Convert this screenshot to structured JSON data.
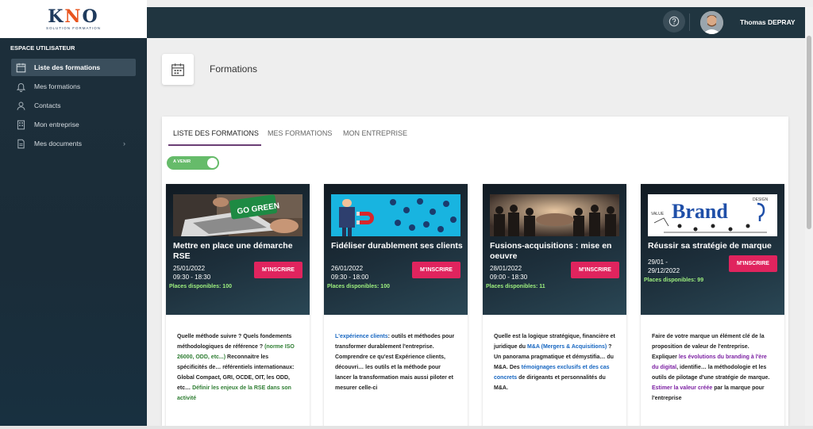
{
  "logo": {
    "brand": "KNO",
    "tagline": "SOLUTION FORMATION"
  },
  "sidebar": {
    "heading": "ESPACE UTILISATEUR",
    "items": [
      {
        "label": "Liste des formations",
        "icon": "calendar-icon",
        "active": true
      },
      {
        "label": "Mes formations",
        "icon": "bell-icon",
        "active": false
      },
      {
        "label": "Contacts",
        "icon": "person-icon",
        "active": false
      },
      {
        "label": "Mon entreprise",
        "icon": "building-icon",
        "active": false
      },
      {
        "label": "Mes documents",
        "icon": "document-icon",
        "active": false,
        "expandable": true
      }
    ]
  },
  "topbar": {
    "user_name": "Thomas DEPRAY",
    "help_icon": "help-icon"
  },
  "page": {
    "title": "Formations",
    "icon": "calendar-icon"
  },
  "tabs": [
    {
      "label": "LISTE DES FORMATIONS",
      "active": true
    },
    {
      "label": "MES FORMATIONS",
      "active": false
    },
    {
      "label": "MON ENTREPRISE",
      "active": false
    }
  ],
  "toggle": {
    "label": "A VENIR",
    "on": true
  },
  "cards": [
    {
      "title": "Mettre en place une démarche RSE",
      "date": "25/01/2022",
      "time": "09:30 - 18:30",
      "button": "M'INSCRIRE",
      "places": "Places disponibles: 100",
      "description": {
        "p1": "Quelle méthode suivre ? Quels fondements méthodologiques de référence ? ",
        "h1": "(norme ISO 26000, ODD, etc...)",
        "p2": " Reconnaitre les spécificités de… référentiels internationaux: Global Compact, GRI, OCDE, OIT, les ODD, etc… ",
        "h2": "Définir les enjeux de la RSE dans son activité"
      }
    },
    {
      "title": "Fidéliser durablement ses clients",
      "date": "26/01/2022",
      "time": "09:30 - 18:00",
      "button": "M'INSCRIRE",
      "places": "Places disponibles: 100",
      "description": {
        "h1": "L'expérience clients",
        "p1": ": outils et méthodes pour transformer durablement l'entreprise. Comprendre ce qu'est Expérience clients, découvri… les outils et la méthode pour lancer la transformation mais aussi piloter et mesurer celle-ci"
      }
    },
    {
      "title": "Fusions-acquisitions : mise en oeuvre",
      "date": "28/01/2022",
      "time": "09:00 - 18:30",
      "button": "M'INSCRIRE",
      "places": "Places disponibles: 11",
      "description": {
        "p1": "Quelle est la logique stratégique, financière et juridique du ",
        "h1": "M&A (Mergers & Acquisitions)",
        "p2": " ? Un panorama pragmatique et démystifia… du M&A. Des ",
        "h2": "témoignages exclusifs et des cas concrets",
        "p3": " de dirigeants et personnalités du M&A."
      }
    },
    {
      "title": "Réussir sa stratégie de marque",
      "date": "29/01 - 29/12/2022",
      "date_line1": "29/01 -",
      "date_line2": "29/12/2022",
      "button": "M'INSCRIRE",
      "places": "Places disponibles: 99",
      "description": {
        "p1": "Faire de votre marque un élément clé de la proposition de valeur de l'entreprise. Expliquer ",
        "h1": "les évolutions du branding à l'ère du digital",
        "p2": ", identifie… la méthodologie et les outils de pilotage d'une stratégie de marque. ",
        "h2": "Estimer la valeur créée",
        "p3": " par la marque pour l'entreprise"
      }
    }
  ],
  "card_images": [
    {
      "sign_text": "GO GREEN"
    },
    {},
    {},
    {
      "word": "Brand",
      "small_top": "DESIGN",
      "small_left": "VALUE"
    }
  ]
}
